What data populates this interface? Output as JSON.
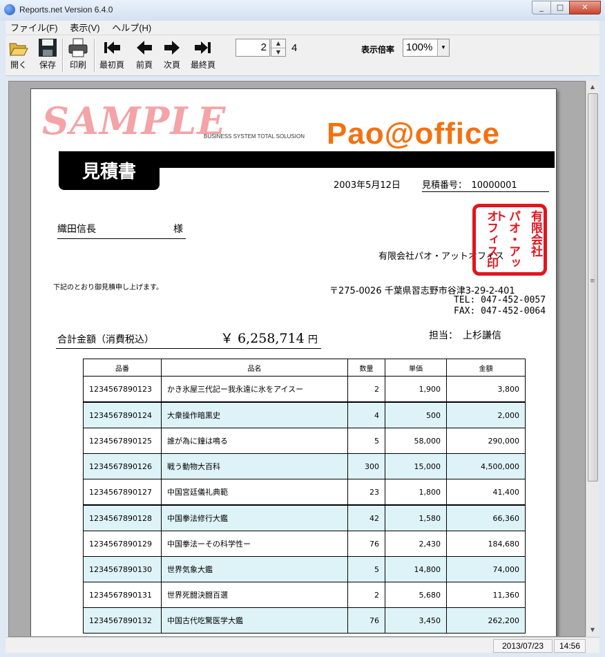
{
  "window": {
    "title": "Reports.net Version 6.4.0"
  },
  "menu": [
    "ファイル(F)",
    "表示(V)",
    "ヘルプ(H)"
  ],
  "toolbar": {
    "open": "開く",
    "save": "保存",
    "print": "印刷",
    "first": "最初頁",
    "prev": "前頁",
    "next": "次頁",
    "last": "最終頁",
    "page_value": "2",
    "page_total": "4",
    "zoom_label": "表示倍率",
    "zoom_value": "100%"
  },
  "document": {
    "watermark": "SAMPLE",
    "tagline": "BUSINESS SYSTEM TOTAL SOLUSION",
    "logo": "Pao@office",
    "doc_title": "見積書",
    "date": "2003年5月12日",
    "quote_no": "見積番号：　10000001",
    "customer": "織田信長",
    "honorific": "様",
    "company": "有限会社パオ・アットオフィス",
    "stamp_cols": [
      "有限会社",
      "パオ・アット",
      "オフィス印"
    ],
    "notice": "下記のとおり御見積申し上げます。",
    "address": "〒275-0026 千葉県習志野市谷津3-29-2-401",
    "tel": "TEL: 047-452-0057",
    "fax": "FAX: 047-452-0064",
    "total_label": "合計金額（消費税込）",
    "total_value": "￥ 6,258,714",
    "total_unit": "円",
    "staff": "担当：　上杉謙信",
    "table": {
      "headers": [
        "品番",
        "品名",
        "数量",
        "単価",
        "金額"
      ],
      "rows": [
        [
          "1234567890123",
          "かき氷屋三代記ー我永遠に氷をアイスー",
          "2",
          "1,900",
          "3,800"
        ],
        [
          "1234567890124",
          "大衆操作暗黒史",
          "4",
          "500",
          "2,000"
        ],
        [
          "1234567890125",
          "誰が為に鐘は鳴る",
          "5",
          "58,000",
          "290,000"
        ],
        [
          "1234567890126",
          "戦う動物大百科",
          "300",
          "15,000",
          "4,500,000"
        ],
        [
          "1234567890127",
          "中国宮廷儀礼典範",
          "23",
          "1,800",
          "41,400"
        ],
        [
          "1234567890128",
          "中国拳法修行大鑑",
          "42",
          "1,580",
          "66,360"
        ],
        [
          "1234567890129",
          "中国拳法ーその科学性ー",
          "76",
          "2,430",
          "184,680"
        ],
        [
          "1234567890130",
          "世界気象大鑑",
          "5",
          "14,800",
          "74,000"
        ],
        [
          "1234567890131",
          "世界死闘決闘百選",
          "2",
          "5,680",
          "11,360"
        ],
        [
          "1234567890132",
          "中国古代吃驚医学大鑑",
          "76",
          "3,450",
          "262,200"
        ]
      ]
    }
  },
  "status": {
    "date": "2013/07/23",
    "time": "14:56"
  }
}
